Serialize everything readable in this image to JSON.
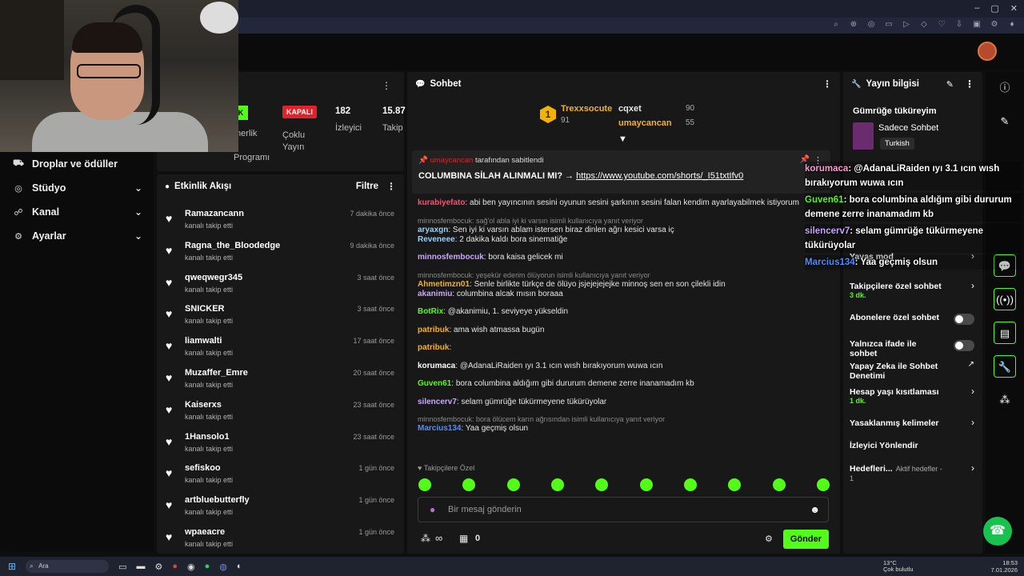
{
  "browser": {
    "window_controls": [
      "–",
      "▢",
      "✕"
    ],
    "ext_icons": [
      "⌕",
      "⊕",
      "◎",
      "▭",
      "▷",
      "◇",
      "♡",
      "⇩",
      "▣",
      "⚙",
      "♦"
    ]
  },
  "nav": {
    "items": [
      {
        "label": "Droplar ve ödüller",
        "icon": "gift-icon",
        "glyph": "⛟",
        "chevron": false
      },
      {
        "label": "Stüdyo",
        "icon": "studio-icon",
        "glyph": "◎",
        "chevron": true
      },
      {
        "label": "Kanal",
        "icon": "channel-icon",
        "glyph": "☍",
        "chevron": true
      },
      {
        "label": "Ayarlar",
        "icon": "gear-icon",
        "glyph": "⚙",
        "chevron": true
      }
    ]
  },
  "stats": {
    "title_partial": "eri",
    "chip_green": "K",
    "chip_red": "KAPALI",
    "col1": [
      "tnerlik",
      "r",
      "Programı"
    ],
    "col2": [
      "Çoklu",
      "Yayın"
    ],
    "viewers": "182",
    "viewers_label": "İzleyici",
    "followers": "15.87",
    "followers_label": "Takip"
  },
  "activity": {
    "title": "Etkinlik Akışı",
    "filter": "Filtre",
    "items": [
      {
        "name": "Ramazancann",
        "sub": "kanalı takip etti",
        "time": "7 dakika önce"
      },
      {
        "name": "Ragna_the_Bloodedge",
        "sub": "kanalı takip etti",
        "time": "9 dakika önce"
      },
      {
        "name": "qweqwegr345",
        "sub": "kanalı takip etti",
        "time": "3 saat önce"
      },
      {
        "name": "SNICKER",
        "sub": "kanalı takip etti",
        "time": "3 saat önce"
      },
      {
        "name": "liamwalti",
        "sub": "kanalı takip etti",
        "time": "17 saat önce"
      },
      {
        "name": "Muzaffer_Emre",
        "sub": "kanalı takip etti",
        "time": "20 saat önce"
      },
      {
        "name": "Kaiserxs",
        "sub": "kanalı takip etti",
        "time": "23 saat önce"
      },
      {
        "name": "1Hansolo1",
        "sub": "kanalı takip etti",
        "time": "23 saat önce"
      },
      {
        "name": "sefiskoo",
        "sub": "kanalı takip etti",
        "time": "1 gün önce"
      },
      {
        "name": "artbluebutterfly",
        "sub": "kanalı takip etti",
        "time": "1 gün önce"
      },
      {
        "name": "wpaeacre",
        "sub": "kanalı takip etti",
        "time": "1 gün önce"
      }
    ]
  },
  "chat": {
    "title": "Sohbet",
    "leaderboard": {
      "first": {
        "rank": "1",
        "name": "Trexxsocute",
        "score": "91"
      },
      "second": {
        "name": "cqxet",
        "score": "90",
        "color": "#ffffff"
      },
      "third": {
        "name": "umaycancan",
        "score": "55",
        "color": "#f0b22c"
      }
    },
    "pinned": {
      "by": "umaycancan",
      "by_suffix": "tarafından sabitlendi",
      "text": "COLUMBINA SİLAH ALINMALI MI? →",
      "link": "https://www.youtube.com/shorts/_I51txtIfv0"
    },
    "messages": [
      {
        "reply": "",
        "user": "kurabiyefato",
        "color": "#ff4f6d",
        "text": "abi ben yayıncının sesini oyunun sesini şarkının sesini falan kendim ayarlayabilmek istiyorum"
      },
      {
        "reply": "minnosfembocuk: sağ'ol abla iyi ki varsın isimli kullanıcıya yanıt veriyor",
        "user": "aryaxgn",
        "color": "#8ed3ff",
        "text": "Sen iyi ki varsın ablam istersen biraz dinlen ağrı kesici varsa iç"
      },
      {
        "reply": "",
        "user": "Reveneee",
        "color": "#8ed3ff",
        "text": "2 dakika kaldı bora sinematiğe"
      },
      {
        "reply": "",
        "user": "minnosfembocuk",
        "color": "#c9a7ff",
        "text": "bora kaisa gelicek mi"
      },
      {
        "reply": "minnosfembocuk: yeşekür ederim ölüyorun isimli kullanıcıya yanıt veriyor",
        "user": "Ahmetimzn01",
        "color": "#f0b22c",
        "text": "Senle birlikte türkçe de ölüyo jsjejejejejke minnoş sen en son çilekli idin"
      },
      {
        "reply": "",
        "user": "akanimiu",
        "color": "#c9a7ff",
        "text": "columbina alcak mısın boraaa"
      },
      {
        "reply": "",
        "user": "BotRix",
        "color": "#53fc18",
        "text": "@akanimiu, 1. seviyeye yükseldin"
      },
      {
        "reply": "",
        "user": "patribuk",
        "color": "#f0b22c",
        "text": "ama wish atmassa bugün"
      },
      {
        "reply": "",
        "user": "patribuk",
        "color": "#f0b22c",
        "text": ""
      },
      {
        "reply": "",
        "user": "korumaca",
        "color": "#ffffff",
        "text": "@AdanaLiRaiden ıyı 3.1 ıcın wısh bırakıyorum wuwa ıcın"
      },
      {
        "reply": "",
        "user": "Guven61",
        "color": "#53fc18",
        "text": "bora columbina aldığım gibi dururum demene zerre inanamadım kb"
      },
      {
        "reply": "",
        "user": "silencerv7",
        "color": "#c9a7ff",
        "text": "selam gümrüğe tükürmeyene tükürüyolar"
      },
      {
        "reply": "minnosfembocuk: bora ölücem karın ağrısından isimli kullanıcıya yanıt veriyor",
        "user": "Marcius134",
        "color": "#4f8fff",
        "text": "Yaa geçmiş olsun"
      }
    ],
    "followers_only": "Takipçilere Özel",
    "input_placeholder": "Bir mesaj gönderin",
    "points": "∞",
    "gift_count": "0",
    "send_label": "Gönder",
    "emote_count": 10
  },
  "info": {
    "title": "Yayın bilgisi",
    "stream_title": "Gümrüğe tüküreyim",
    "category": "Sadece Sohbet",
    "language": "Turkish",
    "settings": [
      {
        "label": "Yavaş mod",
        "sub": "",
        "control": "chevron"
      },
      {
        "label": "Takipçilere özel sohbet",
        "sub": "3 dk.",
        "control": "chevron"
      },
      {
        "label": "Abonelere özel sohbet",
        "sub": "",
        "control": "toggle"
      },
      {
        "label": "Yalnızca ifade ile sohbet",
        "sub": "",
        "control": "toggle"
      },
      {
        "label": "Yapay Zeka ile Sohbet Denetimi",
        "sub": "",
        "control": "external"
      },
      {
        "label": "Hesap yaşı kısıtlaması",
        "sub": "1 dk.",
        "control": "chevron"
      },
      {
        "label": "Yasaklanmış kelimeler",
        "sub": "",
        "control": "chevron"
      },
      {
        "label": "İzleyici Yönlendir",
        "sub": "",
        "control": "none"
      },
      {
        "label": "Hedefleri...",
        "sub": "Aktif hedefler - 1",
        "control": "chevron"
      }
    ]
  },
  "overlay": {
    "lines": [
      {
        "user": "korumaca",
        "color": "#ff9ad5",
        "text": ": @AdanaLiRaiden ıyı 3.1 ıcın wısh bırakıyorum wuwa ıcın"
      },
      {
        "user": "Guven61",
        "color": "#53fc18",
        "text": ": bora columbina aldığım gibi dururum demene zerre inanamadım kb"
      },
      {
        "user": "silencerv7",
        "color": "#c9a7ff",
        "text": ": selam gümrüğe tükürmeyene tükürüyolar"
      },
      {
        "user": "Marcius134",
        "color": "#4f8fff",
        "text": ": Yaa geçmiş olsun"
      }
    ]
  },
  "taskbar": {
    "search": "Ara",
    "weather_temp": "13°C",
    "weather_desc": "Çok bulutlu",
    "time": "18:53",
    "date": "7.01.2026"
  }
}
